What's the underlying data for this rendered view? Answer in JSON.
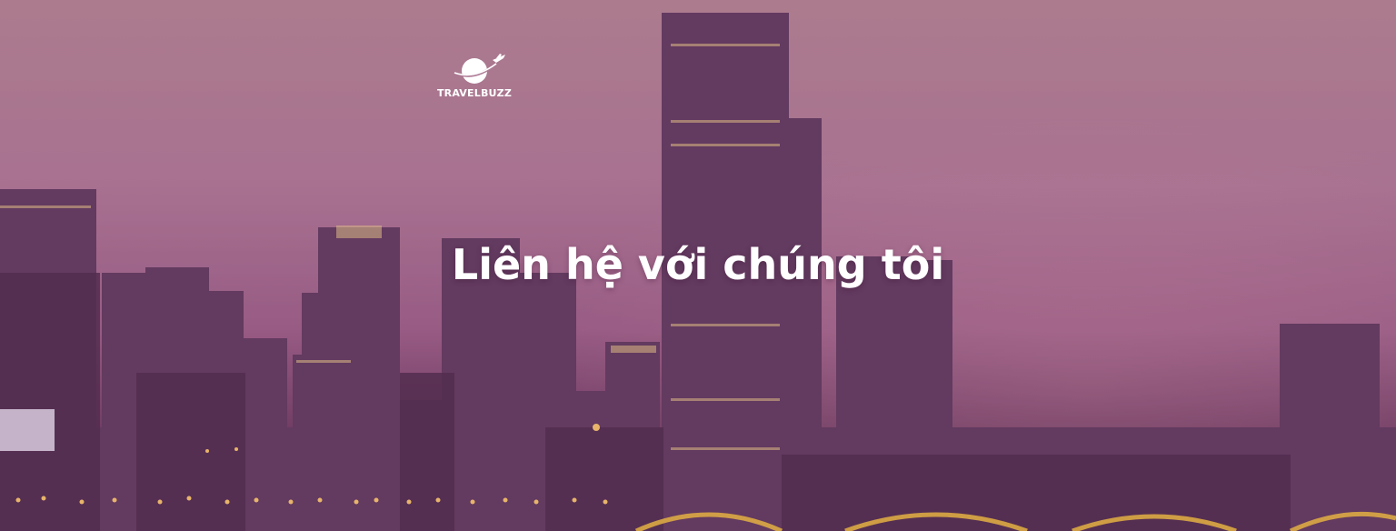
{
  "brand": {
    "name": "TRAVELBUZZ",
    "logo_icon": "planet-airplane-icon"
  },
  "hero": {
    "title": "Liên hệ với chúng tôi",
    "background": "city-skyline-at-dusk-image"
  },
  "colors": {
    "title_text": "#ffffff",
    "sky_top": "#b78a95",
    "sky_mid": "#b27d98",
    "sky_low": "#9f6289",
    "ground": "#3b2337"
  }
}
